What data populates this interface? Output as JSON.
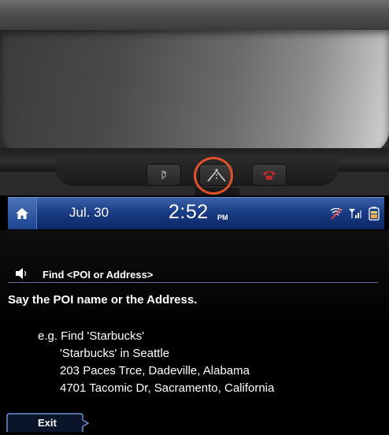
{
  "mirror": {
    "buttons": [
      {
        "name": "voice-recognition-button",
        "icon": "voice-command-icon"
      },
      {
        "name": "blue-link-button",
        "icon": "road-navigation-icon"
      },
      {
        "name": "emergency-call-button",
        "icon": "phone-icon"
      }
    ],
    "highlight_color": "#e2502a"
  },
  "status_bar": {
    "date": "Jul. 30",
    "time": "2:52",
    "ampm": "PM",
    "icons": [
      "home-icon",
      "wifi-off-icon",
      "signal-icon",
      "battery-icon"
    ]
  },
  "voice": {
    "mode_label": "Find <POI or Address>",
    "prompt": "Say the POI name or the Address.",
    "examples": [
      "e.g. Find 'Starbucks'",
      "'Starbucks' in Seattle",
      "203 Paces Trce, Dadeville, Alabama",
      "4701 Tacomic Dr, Sacramento, California"
    ]
  },
  "footer": {
    "exit_label": "Exit"
  },
  "colors": {
    "status_bar": "#1a3d86",
    "screen_background": "#000000",
    "text": "#ffffff",
    "accent_line": "#5a6f9c"
  }
}
